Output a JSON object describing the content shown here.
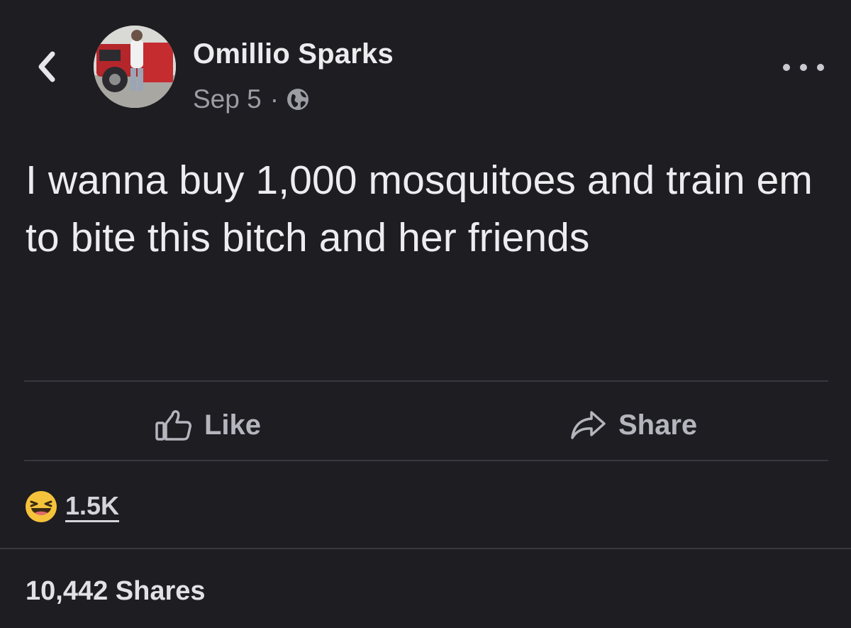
{
  "post": {
    "author": "Omillio Sparks",
    "date": "Sep 5",
    "separator": "·",
    "privacy_icon": "globe-icon",
    "text": "I wanna buy 1,000 mosquitoes and train em to bite this bitch and her friends"
  },
  "actions": {
    "like_label": "Like",
    "share_label": "Share"
  },
  "reactions": {
    "icon": "haha-emoji-icon",
    "count": "1.5K"
  },
  "shares": {
    "label": "10,442 Shares"
  },
  "colors": {
    "background": "#1e1d22",
    "text": "#ededf0",
    "muted": "#9c9ca4",
    "divider": "#38373e",
    "emoji_yellow": "#f5c33b"
  }
}
